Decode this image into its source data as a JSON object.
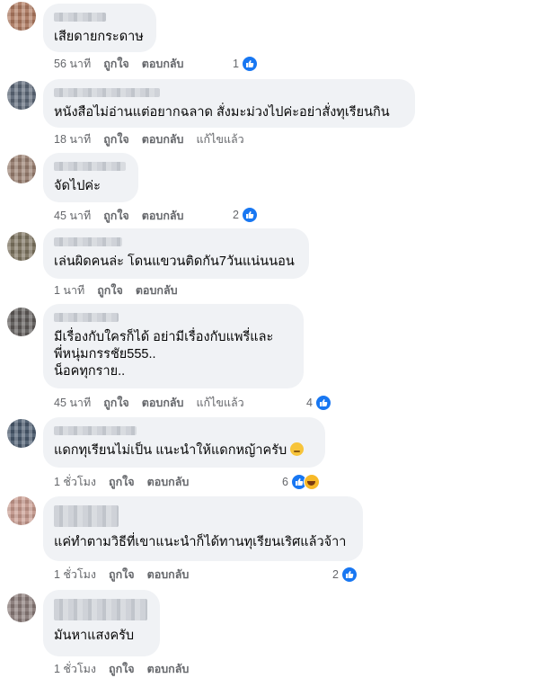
{
  "comments": [
    {
      "text": "เสียดายกระดาษ",
      "time": "56 นาที",
      "like": "ถูกใจ",
      "reply": "ตอบกลับ",
      "edited": "",
      "reactions": "1"
    },
    {
      "text": "หนังสือไม่อ่านแต่อยากฉลาด สั่งมะม่วงไปค่ะอย่าสั่งทุเรียนกิน",
      "time": "18 นาที",
      "like": "ถูกใจ",
      "reply": "ตอบกลับ",
      "edited": "แก้ไขแล้ว",
      "reactions": ""
    },
    {
      "text": "จัดไปค่ะ",
      "time": "45 นาที",
      "like": "ถูกใจ",
      "reply": "ตอบกลับ",
      "edited": "",
      "reactions": "2"
    },
    {
      "text": "เล่นผิดคนล่ะ โดนแขวนติดกัน7วันแน่นนอน",
      "time": "1 นาที",
      "like": "ถูกใจ",
      "reply": "ตอบกลับ",
      "edited": "",
      "reactions": ""
    },
    {
      "text": "มีเรื่องกับใครก็ได้ อย่ามีเรื่องกับแพรี่และ\nพี่หนุ่มกรรชัย555..\nน็อคทุกราย..",
      "time": "45 นาที",
      "like": "ถูกใจ",
      "reply": "ตอบกลับ",
      "edited": "แก้ไขแล้ว",
      "reactions": "4"
    },
    {
      "text": "แดกทุเรียนไม่เป็น แนะนำให้แดกหญ้าครับ",
      "time": "1 ชั่วโมง",
      "like": "ถูกใจ",
      "reply": "ตอบกลับ",
      "edited": "",
      "reactions": "6"
    },
    {
      "text": "แค่ทำตามวิธีที่เขาแนะนำก็ได้ทานทุเรียนเริศแล้วจ้าา",
      "time": "1 ชั่วโมง",
      "like": "ถูกใจ",
      "reply": "ตอบกลับ",
      "edited": "",
      "reactions": "2"
    },
    {
      "text": "มันหาแสงครับ",
      "time": "1 ชั่วโมง",
      "like": "ถูกใจ",
      "reply": "ตอบกลับ",
      "edited": "",
      "reactions": ""
    }
  ],
  "icons": {
    "like": "like-thumb-icon",
    "haha": "haha-emoji-icon",
    "emoji": "face-emoji-icon"
  },
  "colors": {
    "bubble": "#f0f2f5",
    "meta": "#65676b",
    "like_blue": "#1877f2"
  }
}
